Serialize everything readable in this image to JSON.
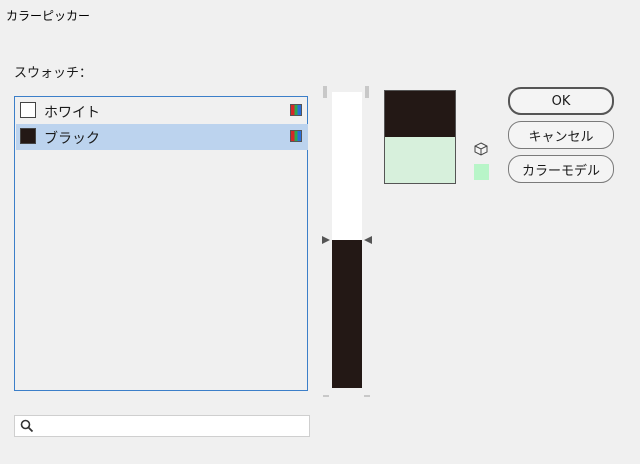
{
  "window": {
    "title": "カラーピッカー"
  },
  "swatches": {
    "label": "スウォッチ：",
    "items": [
      {
        "label": "ホワイト",
        "color": "#ffffff",
        "selected": false
      },
      {
        "label": "ブラック",
        "color": "#231815",
        "selected": true
      }
    ]
  },
  "search": {
    "value": "",
    "placeholder": ""
  },
  "slider": {
    "value": 0.5,
    "fill_color": "#231815"
  },
  "preview": {
    "new_color": "#231815",
    "old_color": "#d7f0dc"
  },
  "websafe": {
    "color": "#b8f5c8"
  },
  "buttons": {
    "ok": "OK",
    "cancel": "キャンセル",
    "color_model": "カラーモデル"
  }
}
